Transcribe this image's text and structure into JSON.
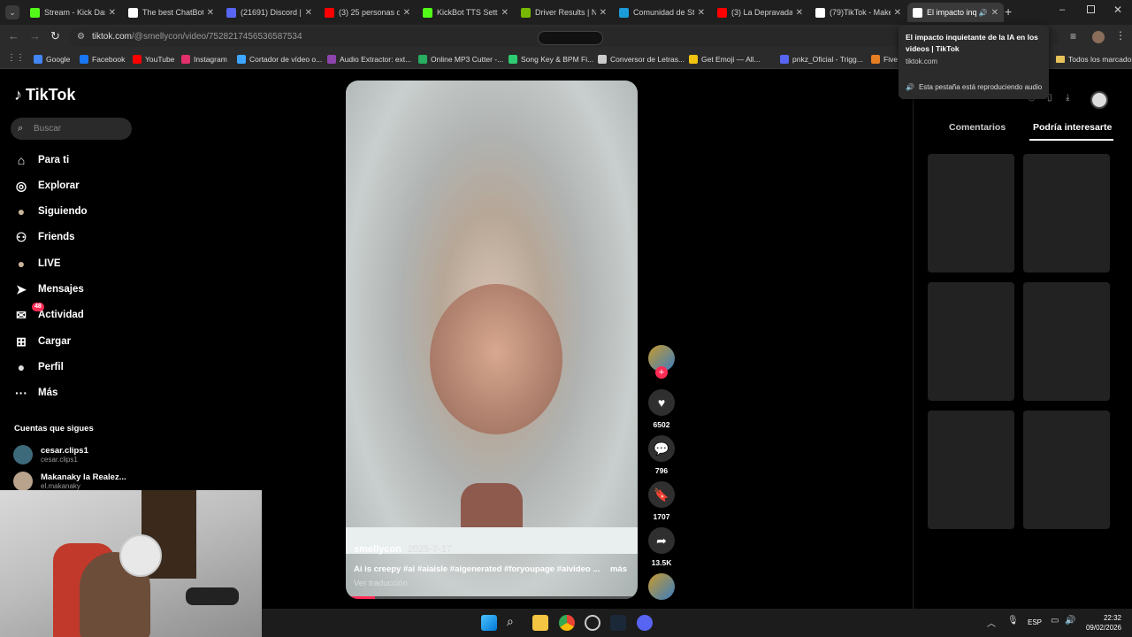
{
  "browser": {
    "tabs": [
      {
        "title": "Stream - Kick Das",
        "color": "#53fc18"
      },
      {
        "title": "The best ChatBot",
        "color": "#ffffff"
      },
      {
        "title": "(21691) Discord |",
        "color": "#5865f2"
      },
      {
        "title": "(3) 25 personas d",
        "color": "#ff0000"
      },
      {
        "title": "KickBot TTS Settin",
        "color": "#53fc18"
      },
      {
        "title": "Driver Results | N",
        "color": "#76b900"
      },
      {
        "title": "Comunidad de St",
        "color": "#1b9bd7"
      },
      {
        "title": "(3) La Depravada",
        "color": "#ff0000"
      },
      {
        "title": "(79)TikTok - Make",
        "color": "#ffffff"
      },
      {
        "title": "El impacto inq",
        "color": "#ffffff"
      }
    ],
    "url_host": "tiktok.com",
    "url_path": "/@smellycon/video/7528217456536587534",
    "bookmarks": [
      {
        "label": "Google",
        "color": "#4285f4"
      },
      {
        "label": "Facebook",
        "color": "#1877f2"
      },
      {
        "label": "YouTube",
        "color": "#ff0000"
      },
      {
        "label": "Instagram",
        "color": "#e1306c"
      },
      {
        "label": "Cortador de vídeo o...",
        "color": "#3ea6ff"
      },
      {
        "label": "Audio Extractor: ext...",
        "color": "#8e44ad"
      },
      {
        "label": "Online MP3 Cutter -...",
        "color": "#27ae60"
      },
      {
        "label": "Song Key & BPM Fi...",
        "color": "#2ecc71"
      },
      {
        "label": "Conversor de Letras...",
        "color": "#cccccc"
      },
      {
        "label": "Get Emoji — All...",
        "color": "#f1c40f"
      },
      {
        "label": "pnkz_Oficial - Trigg...",
        "color": "#5865f2"
      },
      {
        "label": "Five",
        "color": "#e67e22"
      }
    ],
    "all_bookmarks": "Todos los marcadores"
  },
  "tooltip": {
    "title": "El impacto inquietante de la IA en los videos | TikTok",
    "host": "tiktok.com",
    "audio": "Esta pestaña está reproduciendo audio"
  },
  "sidebar": {
    "logo": "TikTok",
    "search_placeholder": "Buscar",
    "items": [
      {
        "label": "Para ti",
        "icon": "home-icon"
      },
      {
        "label": "Explorar",
        "icon": "compass-icon"
      },
      {
        "label": "Siguiendo",
        "icon": "avatar-icon"
      },
      {
        "label": "Friends",
        "icon": "friends-icon"
      },
      {
        "label": "LIVE",
        "icon": "live-icon"
      },
      {
        "label": "Mensajes",
        "icon": "send-icon"
      },
      {
        "label": "Actividad",
        "icon": "activity-icon"
      },
      {
        "label": "Cargar",
        "icon": "upload-icon"
      },
      {
        "label": "Perfil",
        "icon": "profile-icon"
      },
      {
        "label": "Más",
        "icon": "more-icon"
      }
    ],
    "activity_badge": "48",
    "following_header": "Cuentas que sigues",
    "accounts": [
      {
        "name": "cesar.clips1",
        "handle": "cesar.clips1"
      },
      {
        "name": "Makanaky la Realez...",
        "handle": "el.makanaky"
      }
    ]
  },
  "video": {
    "author": "smellycon",
    "date": "2025-7-17",
    "caption": "Ai is creepy #ai #aiaisle #aigenerated #foryoupage #aivideo ...",
    "more": "más",
    "translate": "Ver traducción",
    "progress": 0.1
  },
  "actions": {
    "likes": "6502",
    "comments": "796",
    "saves": "1707",
    "shares": "13.5K"
  },
  "right_panel": {
    "tabs": [
      "Comentarios",
      "Podría interesarte"
    ],
    "active_tab": 1
  },
  "taskbar": {
    "lang": "ESP",
    "time": "22:32",
    "date": "09/02/2026"
  },
  "colors": {
    "accent": "#fe2c55",
    "background": "#000000"
  }
}
